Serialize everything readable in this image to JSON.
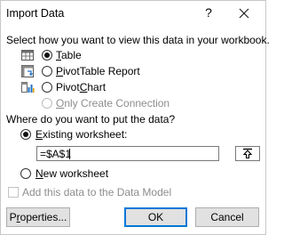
{
  "dialog": {
    "title": "Import Data",
    "help_label": "?"
  },
  "view_section": {
    "prompt": "Select how you want to view this data in your workbook.",
    "options": [
      {
        "label_prefix": "",
        "mnemonic": "T",
        "label_rest": "able",
        "selected": true,
        "enabled": true,
        "icon": "table-icon"
      },
      {
        "label_prefix": "",
        "mnemonic": "P",
        "label_rest": "ivotTable Report",
        "selected": false,
        "enabled": true,
        "icon": "pivottable-icon"
      },
      {
        "label_prefix": "Pivot",
        "mnemonic": "C",
        "label_rest": "hart",
        "selected": false,
        "enabled": true,
        "icon": "pivotchart-icon"
      },
      {
        "label_prefix": "",
        "mnemonic": "O",
        "label_rest": "nly Create Connection",
        "selected": false,
        "enabled": false,
        "icon": "connection-icon"
      }
    ]
  },
  "location_section": {
    "prompt": "Where do you want to put the data?",
    "existing_prefix": "",
    "existing_mnemonic": "E",
    "existing_rest": "xisting worksheet:",
    "existing_selected": true,
    "cell_reference": "=$A$1",
    "new_prefix": "",
    "new_mnemonic": "N",
    "new_rest": "ew worksheet",
    "new_selected": false
  },
  "data_model": {
    "label": "Add this data to the Data Model",
    "checked": false,
    "enabled": false
  },
  "buttons": {
    "properties_mnemonic": "r",
    "properties_prefix": "P",
    "properties_rest": "operties...",
    "ok": "OK",
    "cancel": "Cancel"
  },
  "colors": {
    "accent": "#0078d7",
    "disabled_text": "#8d8d8d",
    "button_face": "#e1e1e1"
  }
}
